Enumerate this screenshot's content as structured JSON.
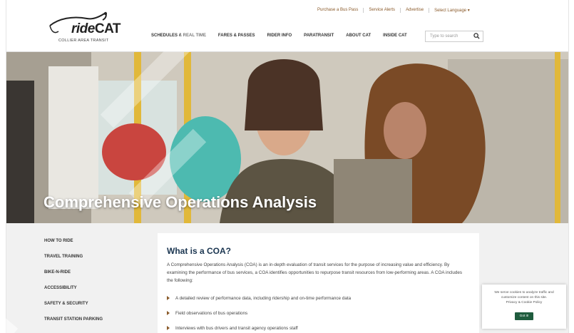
{
  "brand": {
    "logo_main": "ride",
    "logo_bold": "CAT",
    "logo_sub": "COLLIER AREA TRANSIT"
  },
  "utility_nav": [
    "Purchase a Bus Pass",
    "Service Alerts",
    "Advertise",
    "Select Language ▾"
  ],
  "main_nav": [
    "SCHEDULES & REAL TIME",
    "FARES & PASSES",
    "RIDER INFO",
    "PARATRANSIT",
    "ABOUT CAT",
    "INSIDE CAT"
  ],
  "search": {
    "placeholder": "Type to search"
  },
  "hero": {
    "title": "Comprehensive Operations Analysis"
  },
  "sidebar": {
    "items": [
      {
        "label": "HOW TO RIDE"
      },
      {
        "label": "TRAVEL TRAINING"
      },
      {
        "label": "BIKE-N-RIDE"
      },
      {
        "label": "ACCESSIBILITY"
      },
      {
        "label": "SAFETY & SECURITY"
      },
      {
        "label": "TRANSIT STATION PARKING"
      }
    ]
  },
  "content": {
    "heading": "What is a COA?",
    "paragraph": "A Comprehensive Operations Analysis (COA) is an in-depth evaluation of transit services for the purpose of increasing value and efficiency. By examining the performance of bus services, a COA identifies opportunities to repurpose transit resources from low-performing areas. A COA includes the following:",
    "bullets": [
      "A detailed review of performance data, including ridership and on-time performance data",
      "Field observations of bus operations",
      "Interviews with bus drivers and transit agency operations staff"
    ]
  },
  "cookie": {
    "text": "We serve cookies to analyze traffic and customize content on this site.",
    "link": "Privacy & Cookie Policy",
    "button": "Got it!"
  },
  "colors": {
    "accent": "#8a5a2a",
    "heading": "#1a3550",
    "cookie_button": "#1f5c3e"
  }
}
